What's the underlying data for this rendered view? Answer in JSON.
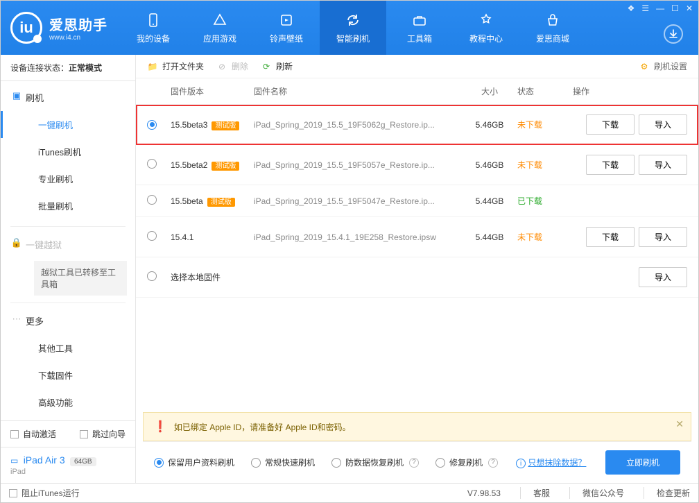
{
  "app": {
    "name": "爱思助手",
    "url": "www.i4.cn",
    "version": "V7.98.53"
  },
  "nav": {
    "items": [
      {
        "label": "我的设备"
      },
      {
        "label": "应用游戏"
      },
      {
        "label": "铃声壁纸"
      },
      {
        "label": "智能刷机",
        "active": true
      },
      {
        "label": "工具箱"
      },
      {
        "label": "教程中心"
      },
      {
        "label": "爱思商城"
      }
    ]
  },
  "connection": {
    "label": "设备连接状态：",
    "mode": "正常模式"
  },
  "sidebar": {
    "flash_root": "刷机",
    "items_flash": [
      "一键刷机",
      "iTunes刷机",
      "专业刷机",
      "批量刷机"
    ],
    "jailbreak": "一键越狱",
    "jailbreak_note": "越狱工具已转移至工具箱",
    "more_root": "更多",
    "items_more": [
      "其他工具",
      "下载固件",
      "高级功能"
    ],
    "auto_activate": "自动激活",
    "skip_guide": "跳过向导"
  },
  "device": {
    "name": "iPad Air 3",
    "capacity": "64GB",
    "type": "iPad"
  },
  "toolbar": {
    "open_folder": "打开文件夹",
    "delete": "删除",
    "refresh": "刷新",
    "settings": "刷机设置"
  },
  "columns": {
    "version": "固件版本",
    "name": "固件名称",
    "size": "大小",
    "status": "状态",
    "ops": "操作"
  },
  "strings": {
    "download": "下载",
    "import": "导入",
    "beta_tag": "测试版",
    "select_local": "选择本地固件"
  },
  "rows": [
    {
      "version": "15.5beta3",
      "beta": true,
      "file": "iPad_Spring_2019_15.5_19F5062g_Restore.ip...",
      "size": "5.46GB",
      "status": "未下载",
      "status_class": "st-orange",
      "selected": true,
      "download": true,
      "import": true,
      "highlight": true
    },
    {
      "version": "15.5beta2",
      "beta": true,
      "file": "iPad_Spring_2019_15.5_19F5057e_Restore.ip...",
      "size": "5.46GB",
      "status": "未下载",
      "status_class": "st-orange",
      "selected": false,
      "download": true,
      "import": true
    },
    {
      "version": "15.5beta",
      "beta": true,
      "file": "iPad_Spring_2019_15.5_19F5047e_Restore.ip...",
      "size": "5.44GB",
      "status": "已下载",
      "status_class": "st-green",
      "selected": false,
      "download": false,
      "import": false
    },
    {
      "version": "15.4.1",
      "beta": false,
      "file": "iPad_Spring_2019_15.4.1_19E258_Restore.ipsw",
      "size": "5.44GB",
      "status": "未下载",
      "status_class": "st-orange",
      "selected": false,
      "download": true,
      "import": true
    }
  ],
  "notice": "如已绑定 Apple ID，请准备好 Apple ID和密码。",
  "flash_options": {
    "opts": [
      {
        "label": "保留用户资料刷机",
        "checked": true
      },
      {
        "label": "常规快速刷机",
        "checked": false
      },
      {
        "label": "防数据恢复刷机",
        "checked": false,
        "help": true
      },
      {
        "label": "修复刷机",
        "checked": false,
        "help": true
      }
    ],
    "erase_link": "只想抹除数据？",
    "go": "立即刷机"
  },
  "footer": {
    "block_itunes": "阻止iTunes运行",
    "items": [
      "客服",
      "微信公众号",
      "检查更新"
    ]
  }
}
